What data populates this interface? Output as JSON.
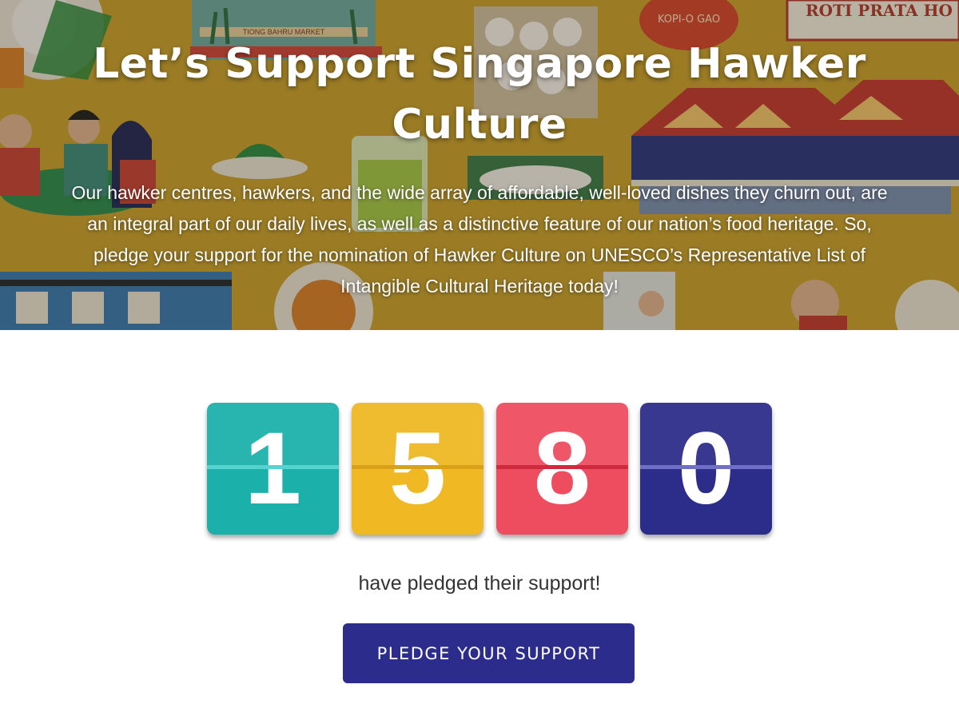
{
  "hero": {
    "title": "Let’s Support Singapore Hawker Culture",
    "description": "Our hawker centres, hawkers, and the wide array of affordable, well-loved dishes they churn out, are an integral part of our daily lives, as well as a distinctive feature of our nation’s food heritage. So, pledge your support for the nomination of Hawker Culture on UNESCO’s Representative List of Intangible Cultural Heritage today!",
    "illustration_signs": {
      "market": "TIONG BAHRU MARKET",
      "kopi": "KOPI-O GAO",
      "prata": "ROTI PRATA HO"
    }
  },
  "counter": {
    "digits": [
      {
        "value": "1",
        "color": "#1bb0aa",
        "seam_color": "#56d3cf"
      },
      {
        "value": "5",
        "color": "#f0b823",
        "seam_color": "#d9a01a"
      },
      {
        "value": "8",
        "color": "#ee4d60",
        "seam_color": "#d02a3e"
      },
      {
        "value": "0",
        "color": "#2c2c8a",
        "seam_color": "#6f6fc8"
      }
    ],
    "caption": "have pledged their support!"
  },
  "cta": {
    "label": "PLEDGE YOUR SUPPORT",
    "color": "#2c2c8c"
  }
}
